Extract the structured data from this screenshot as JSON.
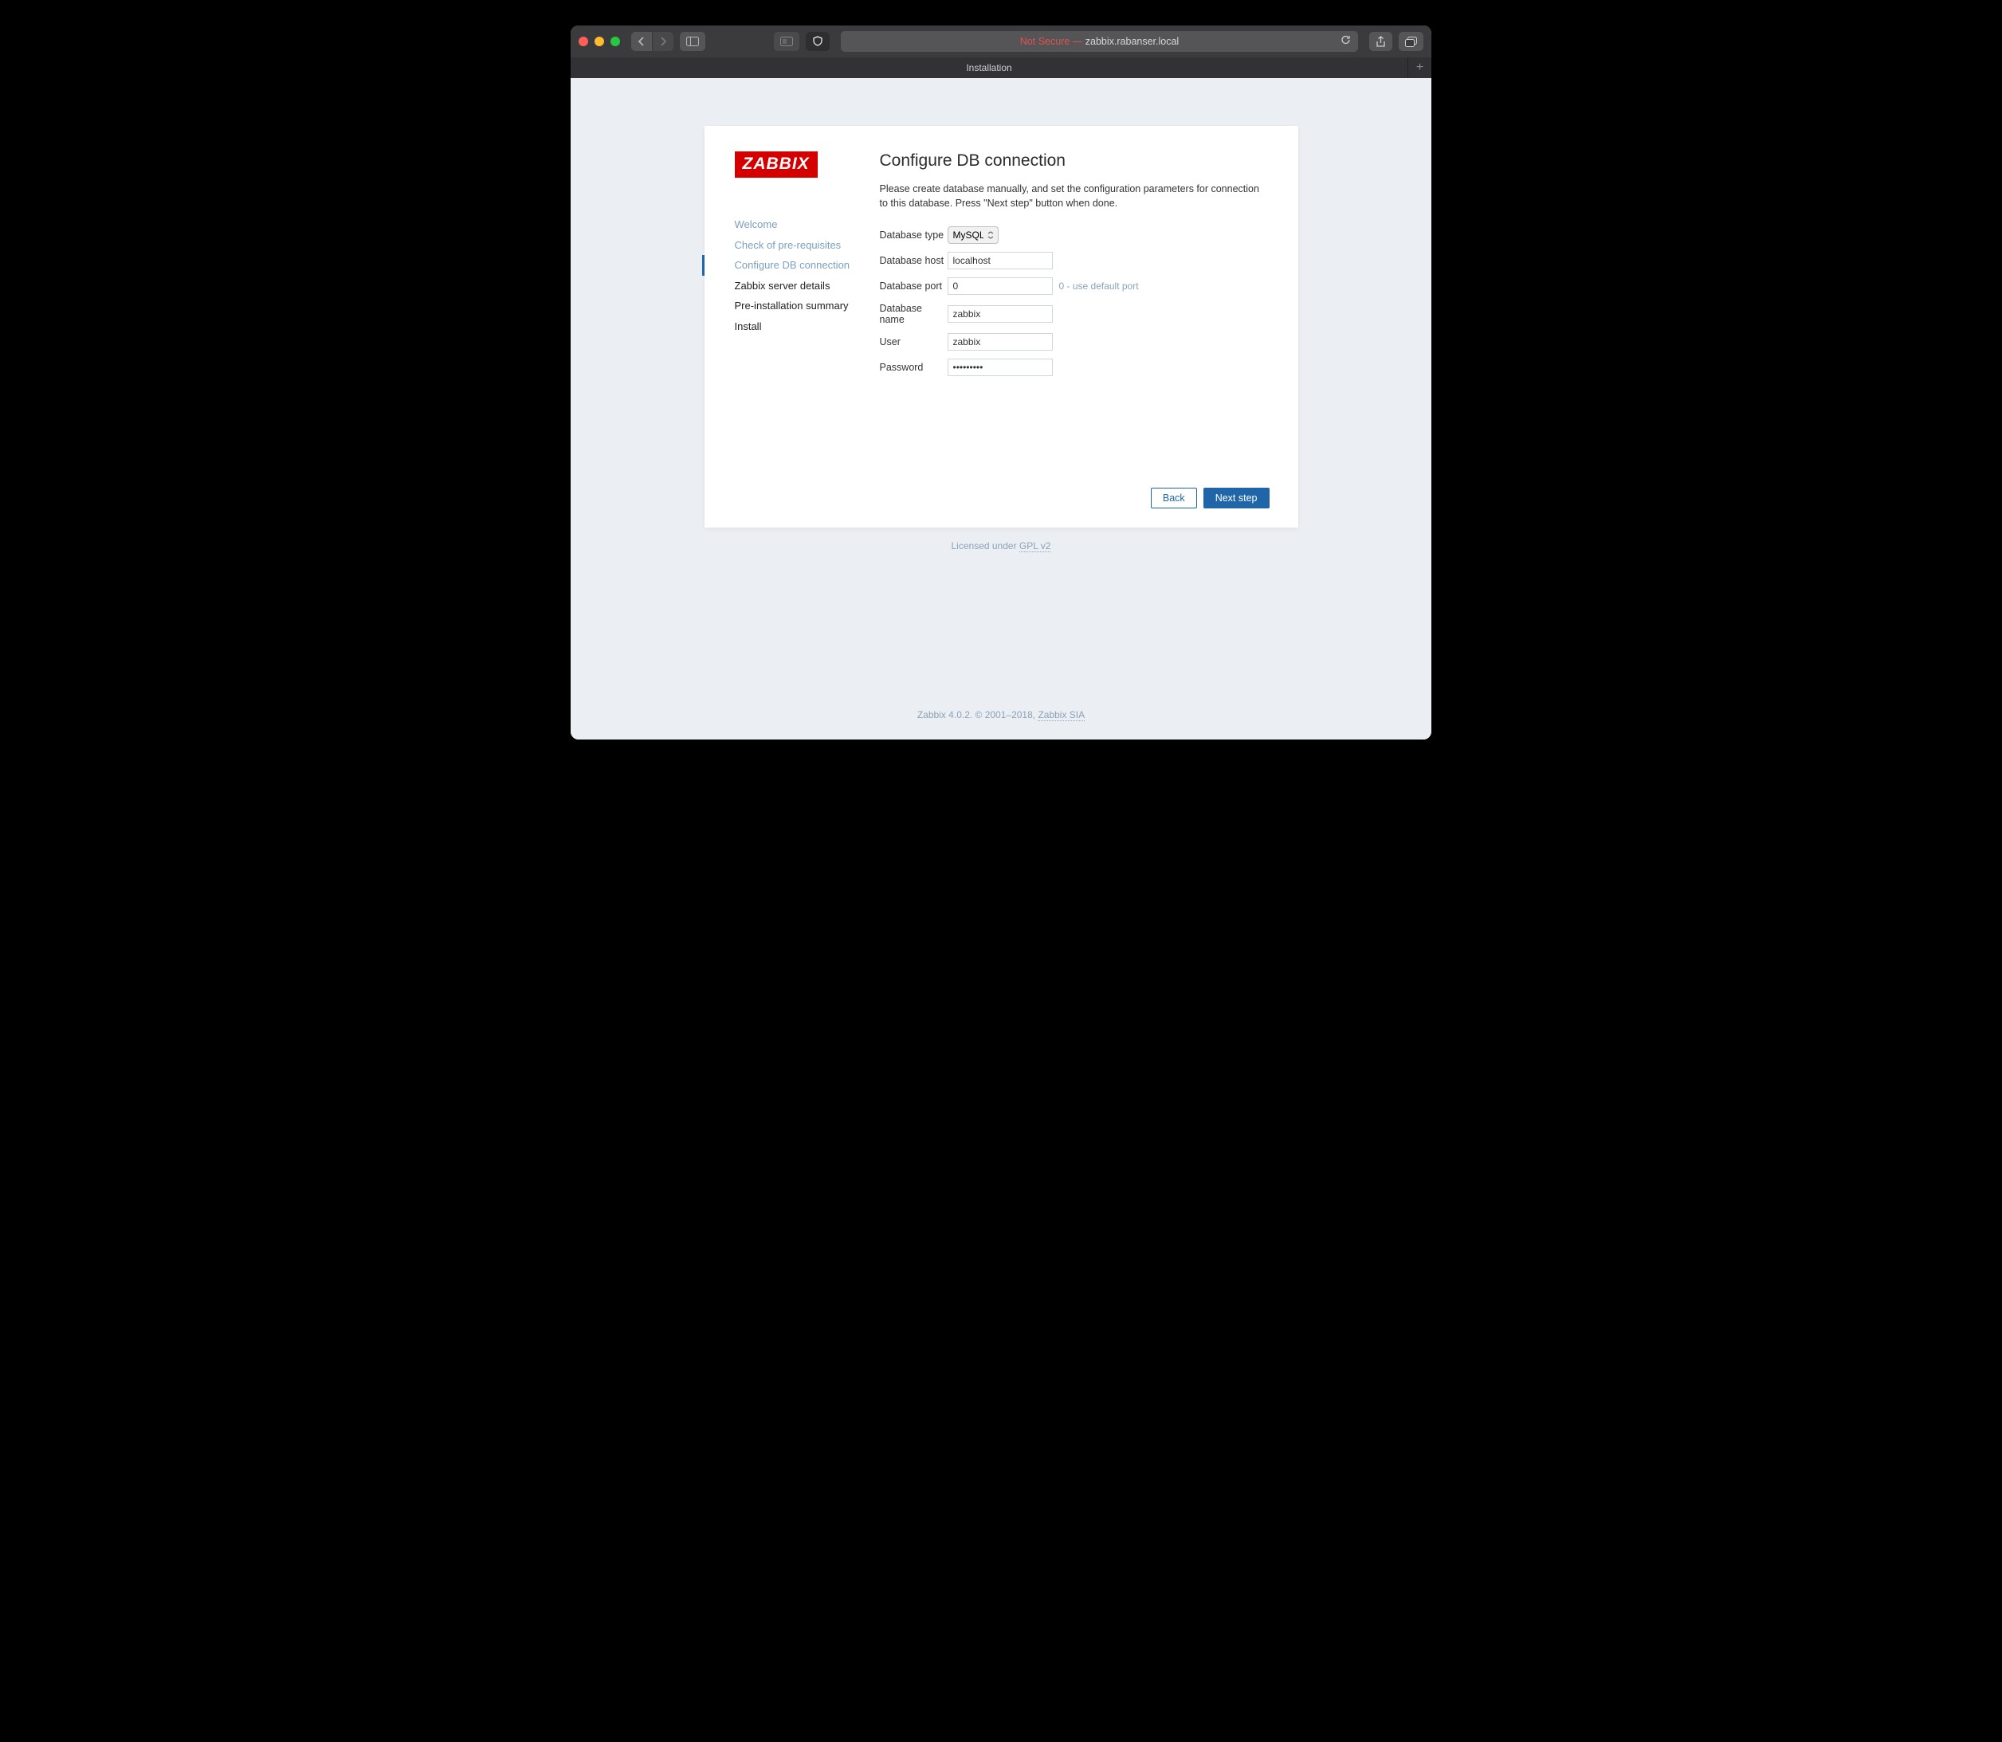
{
  "browser": {
    "not_secure_prefix": "Not Secure — ",
    "url_host": "zabbix.rabanser.local",
    "tab_title": "Installation"
  },
  "logo_text": "ZABBIX",
  "steps": [
    {
      "label": "Welcome",
      "state": "done"
    },
    {
      "label": "Check of pre-requisites",
      "state": "done"
    },
    {
      "label": "Configure DB connection",
      "state": "current"
    },
    {
      "label": "Zabbix server details",
      "state": "todo"
    },
    {
      "label": "Pre-installation summary",
      "state": "todo"
    },
    {
      "label": "Install",
      "state": "todo"
    }
  ],
  "heading": "Configure DB connection",
  "help_text": "Please create database manually, and set the configuration parameters for connection to this database. Press \"Next step\" button when done.",
  "fields": {
    "type": {
      "label": "Database type",
      "value": "MySQL"
    },
    "host": {
      "label": "Database host",
      "value": "localhost"
    },
    "port": {
      "label": "Database port",
      "value": "0",
      "hint": "0 - use default port"
    },
    "name": {
      "label": "Database name",
      "value": "zabbix"
    },
    "user": {
      "label": "User",
      "value": "zabbix"
    },
    "password": {
      "label": "Password",
      "value": "•••••••••"
    }
  },
  "buttons": {
    "back": "Back",
    "next": "Next step"
  },
  "license": {
    "prefix": "Licensed under ",
    "link": "GPL v2"
  },
  "footer": {
    "text": "Zabbix 4.0.2. © 2001–2018, ",
    "link": "Zabbix SIA"
  }
}
